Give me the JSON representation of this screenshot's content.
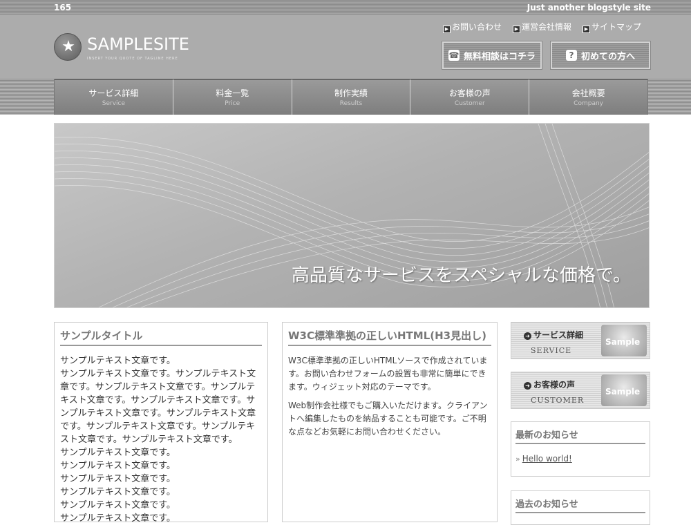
{
  "topbar": {
    "count": "165",
    "tagline": "Just another blogstyle site"
  },
  "logo": {
    "name": "SAMPLESITE",
    "sub": "INSERT YOUR QUOTE OF TAGLINE HERE"
  },
  "toplinks": [
    {
      "label": "お問い合わせ",
      "icon": "play-icon"
    },
    {
      "label": "運営会社情報",
      "icon": "play-icon"
    },
    {
      "label": "サイトマップ",
      "icon": "play-icon"
    }
  ],
  "buttons": {
    "consult": {
      "label": "無料相談はコチラ",
      "icon": "phone-icon"
    },
    "first": {
      "label": "初めての方へ",
      "icon": "question-icon"
    }
  },
  "nav": [
    {
      "jp": "サービス詳細",
      "en": "Service"
    },
    {
      "jp": "料金一覧",
      "en": "Price"
    },
    {
      "jp": "制作実績",
      "en": "Results"
    },
    {
      "jp": "お客様の声",
      "en": "Customer"
    },
    {
      "jp": "会社概要",
      "en": "Company"
    }
  ],
  "hero": {
    "caption": "高品質なサービスをスペシャルな価格で。"
  },
  "col1": {
    "title": "サンプルタイトル",
    "lines": [
      "サンプルテキスト文章です。",
      "サンプルテキスト文章です。サンプルテキスト文章です。サンプルテキスト文章です。サンプルテキスト文章です。サンプルテキスト文章です。サンプルテキスト文章です。サンプルテキスト文章です。サンプルテキスト文章です。サンプルテキスト文章です。サンプルテキスト文章です。",
      "サンプルテキスト文章です。",
      "サンプルテキスト文章です。",
      "サンプルテキスト文章です。",
      "サンプルテキスト文章です。",
      "サンプルテキスト文章です。",
      "サンプルテキスト文章です。"
    ]
  },
  "col2": {
    "title": "W3C標準準拠の正しいHTML(H3見出し)",
    "p1": "W3C標準準拠の正しいHTMLソースで作成されています。お問い合わせフォームの設置も非常に簡単にできます。ウィジェット対応のテーマです。",
    "p2": "Web制作会社様でもご購入いただけます。クライアントへ編集したものを納品することも可能です。ご不明な点などお気軽にお問い合わせください。"
  },
  "banners": [
    {
      "jp": "サービス詳細",
      "en": "SERVICE",
      "photo": "Sample"
    },
    {
      "jp": "お客様の声",
      "en": "CUSTOMER",
      "photo": "Sample"
    }
  ],
  "sidebar": {
    "news_title": "最新のお知らせ",
    "news_link": "Hello world!",
    "past_title": "過去のお知らせ"
  }
}
